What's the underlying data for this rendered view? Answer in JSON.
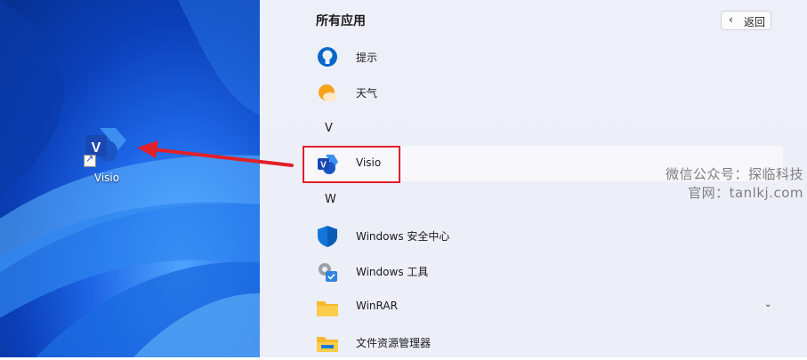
{
  "desktop": {
    "icon_label": "Visio"
  },
  "start_menu": {
    "title": "所有应用",
    "back_label": "返回",
    "items": [
      {
        "type": "app",
        "label": "提示",
        "icon": "tips-icon"
      },
      {
        "type": "app",
        "label": "天气",
        "icon": "weather-icon"
      },
      {
        "type": "letter",
        "label": "V"
      },
      {
        "type": "app",
        "label": "Visio",
        "icon": "visio-icon",
        "highlighted": true
      },
      {
        "type": "letter",
        "label": "W"
      },
      {
        "type": "app",
        "label": "Windows 安全中心",
        "icon": "windows-security-icon"
      },
      {
        "type": "app",
        "label": "Windows 工具",
        "icon": "windows-tools-icon"
      },
      {
        "type": "app",
        "label": "WinRAR",
        "icon": "folder-icon",
        "expandable": true
      },
      {
        "type": "app",
        "label": "文件资源管理器",
        "icon": "file-explorer-icon"
      }
    ]
  },
  "watermark": {
    "line1": "微信公众号：探临科技",
    "line2": "官网：tanlkj.com"
  },
  "colors": {
    "annotation_red": "#e0202a",
    "visio_blue": "#1a55c4"
  }
}
